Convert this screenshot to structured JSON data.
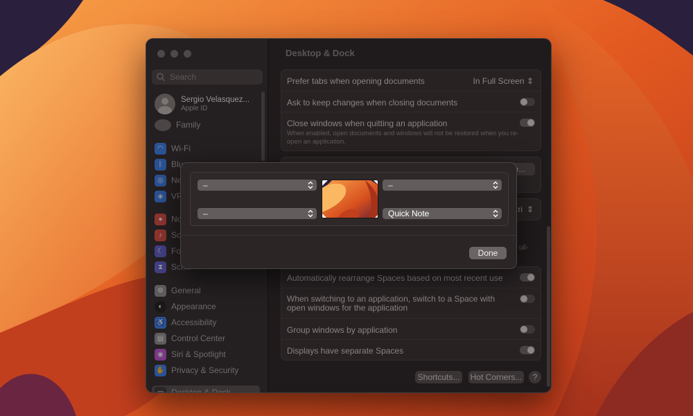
{
  "window": {
    "title": "Desktop & Dock",
    "search_placeholder": "Search"
  },
  "account": {
    "name": "Sergio Velasquez...",
    "subtitle": "Apple ID",
    "family": "Family"
  },
  "sidebar": {
    "items": [
      {
        "label": "Wi-Fi",
        "icon": "wifi-icon",
        "color": "#2f7cf6"
      },
      {
        "label": "Blue...",
        "icon": "bluetooth-icon",
        "color": "#2f7cf6"
      },
      {
        "label": "Net...",
        "icon": "network-icon",
        "color": "#2f7cf6"
      },
      {
        "label": "VPN",
        "icon": "vpn-icon",
        "color": "#2f7cf6"
      },
      {
        "label": "Not...",
        "icon": "notifications-icon",
        "color": "#e8463b"
      },
      {
        "label": "Sou...",
        "icon": "sound-icon",
        "color": "#e8463b"
      },
      {
        "label": "Foc...",
        "icon": "focus-icon",
        "color": "#5b5bd6"
      },
      {
        "label": "Scr...",
        "icon": "screen-time-icon",
        "color": "#5b5bd6"
      },
      {
        "label": "General",
        "icon": "gear-icon",
        "color": "#8e8e93"
      },
      {
        "label": "Appearance",
        "icon": "appearance-icon",
        "color": "#1c1c1e"
      },
      {
        "label": "Accessibility",
        "icon": "accessibility-icon",
        "color": "#2f7cf6"
      },
      {
        "label": "Control Center",
        "icon": "control-center-icon",
        "color": "#8e8e93"
      },
      {
        "label": "Siri & Spotlight",
        "icon": "siri-icon",
        "color": "#c04bd6"
      },
      {
        "label": "Privacy & Security",
        "icon": "hand-icon",
        "color": "#2f7cf6"
      },
      {
        "label": "Desktop & Dock",
        "icon": "dock-icon",
        "color": "#1c1c1e"
      }
    ]
  },
  "windows_settings": {
    "prefer_tabs_label": "Prefer tabs when opening documents",
    "prefer_tabs_value": "In Full Screen",
    "ask_keep_changes_label": "Ask to keep changes when closing documents",
    "close_windows_label": "Close windows when quitting an application",
    "close_windows_sub": "When enabled, open documents and windows will not be restored when you re-open an application."
  },
  "partial": {
    "customize_button": "...ze...",
    "browser_suffix": "ri",
    "full_suffix": "ull-"
  },
  "spaces_settings": {
    "auto_rearrange_label": "Automatically rearrange Spaces based on most recent use",
    "switch_space_label": "When switching to an application, switch to a Space with open windows for the application",
    "group_windows_label": "Group windows by application",
    "separate_spaces_label": "Displays have separate Spaces"
  },
  "footer": {
    "shortcuts_button": "Shortcuts...",
    "hot_corners_button": "Hot Corners...",
    "help_button": "?"
  },
  "hot_corners": {
    "top_left": "–",
    "top_right": "–",
    "bottom_left": "–",
    "bottom_right": "Quick Note",
    "done_button": "Done"
  }
}
